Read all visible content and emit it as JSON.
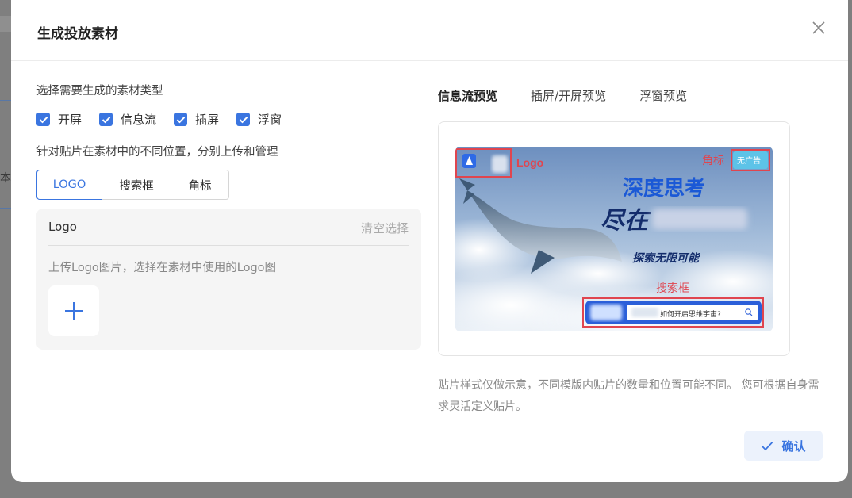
{
  "backdrop": {
    "char": "本"
  },
  "modal": {
    "title": "生成投放素材",
    "type_label": "选择需要生成的素材类型",
    "types": [
      {
        "label": "开屏",
        "checked": true
      },
      {
        "label": "信息流",
        "checked": true
      },
      {
        "label": "插屏",
        "checked": true
      },
      {
        "label": "浮窗",
        "checked": true
      }
    ],
    "position_label": "针对贴片在素材中的不同位置，分别上传和管理",
    "tabs": [
      {
        "label": "LOGO",
        "active": true
      },
      {
        "label": "搜索框",
        "active": false
      },
      {
        "label": "角标",
        "active": false
      }
    ],
    "panel": {
      "title": "Logo",
      "clear": "清空选择",
      "hint": "上传Logo图片，选择在素材中使用的Logo图",
      "add_icon": "plus-icon"
    },
    "preview_tabs": [
      {
        "label": "信息流预览",
        "active": true
      },
      {
        "label": "插屏/开屏预览",
        "active": false
      },
      {
        "label": "浮窗预览",
        "active": false
      }
    ],
    "preview": {
      "logo_label": "Logo",
      "corner_label": "角标",
      "corner_badge": "无广告",
      "headline": "深度思考",
      "subline": "尽在",
      "tagline": "探索无限可能",
      "search_label": "搜索框",
      "search_text": "如何开启思维宇宙?"
    },
    "note": "贴片样式仅做示意，不同模版内贴片的数量和位置可能不同。 您可根据自身需求灵活定义贴片。",
    "confirm": "确认",
    "colors": {
      "accent": "#3a75e0",
      "marker": "#e0454f"
    }
  }
}
